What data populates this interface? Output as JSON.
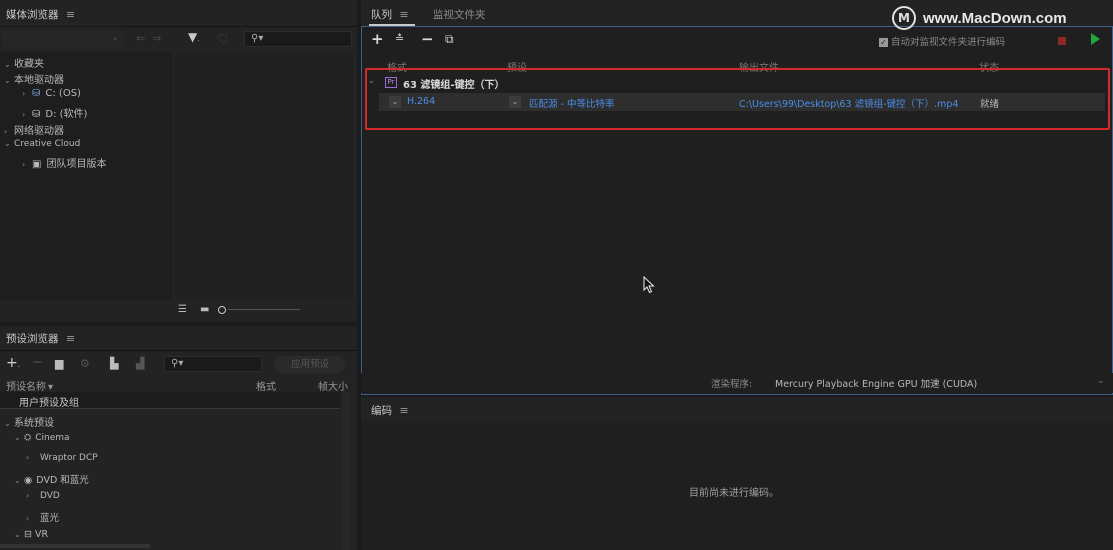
{
  "watermark": {
    "text": "www.MacDown.com",
    "logo": "M"
  },
  "media_browser": {
    "title": "媒体浏览器",
    "menu_icon": "≡",
    "tree": {
      "favorites": "收藏夹",
      "local_drives": "本地驱动器",
      "drive_c": "C: (OS)",
      "drive_d": "D: (软件)",
      "network_drives": "网络驱动器",
      "creative_cloud": "Creative Cloud",
      "team_projects": "团队项目版本"
    }
  },
  "preset_browser": {
    "title": "预设浏览器",
    "menu_icon": "≡",
    "apply_button": "应用预设",
    "columns": {
      "name": "预设名称",
      "format": "格式",
      "frame_size": "帧大小"
    },
    "items": {
      "user_presets": "用户预设及组",
      "system_presets": "系统预设",
      "cinema": "Cinema",
      "wraptor": "Wraptor DCP",
      "dvd_bluray": "DVD 和蓝光",
      "dvd": "DVD",
      "bluray": "蓝光",
      "vr": "VR"
    }
  },
  "queue": {
    "tab_queue": "队列",
    "tab_menu": "≡",
    "tab_watch": "监视文件夹",
    "auto_encode_label": "自动对监视文件夹进行编码",
    "auto_encode_checked": true,
    "columns": {
      "format": "格式",
      "preset": "预设",
      "output": "输出文件",
      "status": "状态"
    },
    "group": {
      "badge": "Pr",
      "title": "63 滤镜组-键控（下）"
    },
    "item": {
      "format": "H.264",
      "preset": "匹配源 - 中等比特率",
      "output": "C:\\Users\\99\\Desktop\\63 滤镜组-键控（下）.mp4",
      "status": "就绪"
    },
    "renderer_label": "渲染程序:",
    "renderer_value": "Mercury Playback Engine GPU 加速 (CUDA)"
  },
  "encoding": {
    "title": "编码",
    "menu_icon": "≡",
    "empty_message": "目前尚未进行编码。"
  },
  "colors": {
    "highlight_box": "#d42a2a",
    "link_blue": "#4a8ee8",
    "stop_red": "#8a2a2a",
    "play_green": "#1fa83a"
  }
}
